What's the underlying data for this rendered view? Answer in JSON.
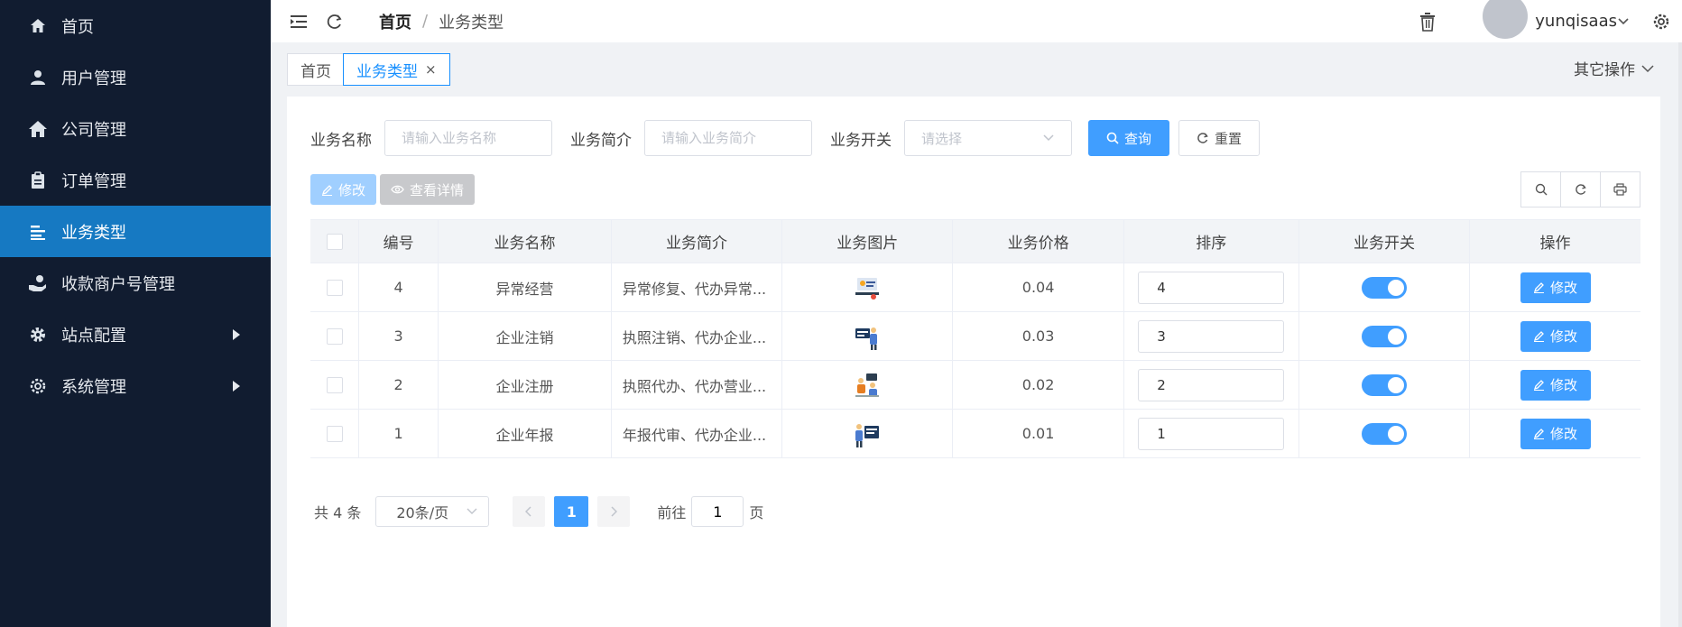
{
  "sidebar": {
    "items": [
      {
        "label": "首页",
        "icon": "home-icon"
      },
      {
        "label": "用户管理",
        "icon": "user-icon"
      },
      {
        "label": "公司管理",
        "icon": "house-icon"
      },
      {
        "label": "订单管理",
        "icon": "clipboard-icon"
      },
      {
        "label": "业务类型",
        "icon": "align-left-icon",
        "active": true
      },
      {
        "label": "收款商户号管理",
        "icon": "hand-money-icon"
      },
      {
        "label": "站点配置",
        "icon": "gear-icon",
        "has_children": true
      },
      {
        "label": "系统管理",
        "icon": "cog-outline-icon",
        "has_children": true
      }
    ]
  },
  "header": {
    "breadcrumb_home": "首页",
    "breadcrumb_sep": "/",
    "breadcrumb_current": "业务类型",
    "username": "yunqisaas"
  },
  "tags": {
    "home": "首页",
    "current": "业务类型",
    "close": "×",
    "other_ops": "其它操作"
  },
  "search": {
    "name_label": "业务名称",
    "name_placeholder": "请输入业务名称",
    "intro_label": "业务简介",
    "intro_placeholder": "请输入业务简介",
    "switch_label": "业务开关",
    "switch_placeholder": "请选择",
    "query_label": "查询",
    "reset_label": "重置"
  },
  "toolbar": {
    "edit_label": "修改",
    "detail_label": "查看详情"
  },
  "table": {
    "headers": {
      "id": "编号",
      "name": "业务名称",
      "intro": "业务简介",
      "image": "业务图片",
      "price": "业务价格",
      "sort": "排序",
      "switch": "业务开关",
      "action": "操作"
    },
    "action_label": "修改",
    "rows": [
      {
        "id": "4",
        "name": "异常经营",
        "intro": "异常修复、代办异常...",
        "price": "0.04",
        "sort": "4",
        "enabled": true
      },
      {
        "id": "3",
        "name": "企业注销",
        "intro": "执照注销、代办企业...",
        "price": "0.03",
        "sort": "3",
        "enabled": true
      },
      {
        "id": "2",
        "name": "企业注册",
        "intro": "执照代办、代办营业...",
        "price": "0.02",
        "sort": "2",
        "enabled": true
      },
      {
        "id": "1",
        "name": "企业年报",
        "intro": "年报代审、代办企业...",
        "price": "0.01",
        "sort": "1",
        "enabled": true
      }
    ]
  },
  "pagination": {
    "total": "共 4 条",
    "page_size": "20条/页",
    "current_page": "1",
    "goto_label": "前往",
    "goto_value": "1",
    "page_suffix": "页"
  },
  "colors": {
    "sidebar_bg": "#111c30",
    "sidebar_active": "#1679c2",
    "primary": "#409eff"
  }
}
